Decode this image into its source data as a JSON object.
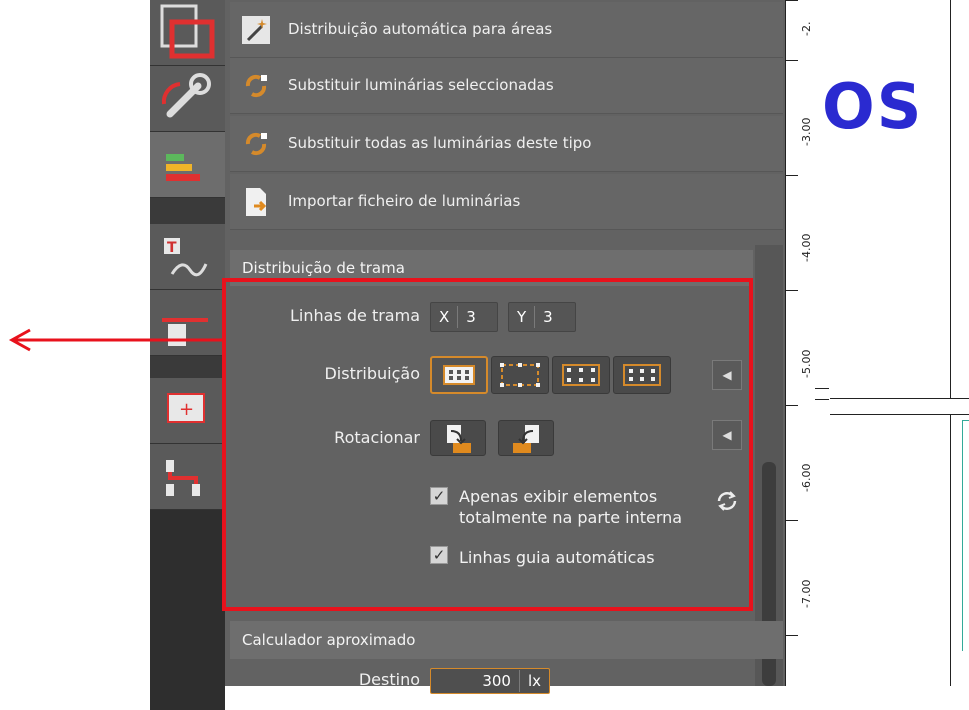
{
  "menu": {
    "items": [
      {
        "label": "Distribuição automática para áreas",
        "icon": "magic-wand-icon"
      },
      {
        "label": "Substituir luminárias seleccionadas",
        "icon": "replace-arrows-icon"
      },
      {
        "label": "Substituir todas as luminárias deste tipo",
        "icon": "replace-all-arrows-icon"
      },
      {
        "label": "Importar ficheiro de luminárias",
        "icon": "import-file-icon"
      }
    ]
  },
  "grid_distribution": {
    "title": "Distribuição de trama",
    "grid_lines_label": "Linhas de trama",
    "x_label": "X",
    "x_value": "3",
    "y_label": "Y",
    "y_value": "3",
    "distribution_label": "Distribuição",
    "rotate_label": "Rotacionar",
    "checkbox_inside_label": "Apenas exibir elementos totalmente na parte interna",
    "checkbox_inside_checked": true,
    "checkbox_guides_label": "Linhas guia automáticas",
    "checkbox_guides_checked": true
  },
  "approx_calculator": {
    "title": "Calculador aproximado",
    "field_label": "Destino",
    "field_value": "300",
    "field_unit": "lx"
  },
  "ruler": {
    "labels": [
      "-2.",
      "-3.00",
      "-4.00",
      "-5.00",
      "-6.00",
      "-7.00"
    ]
  },
  "canvas": {
    "text": "OS"
  },
  "colors": {
    "highlight": "#e8121c",
    "accent": "#d58a2b",
    "canvas_text": "#2a2ad0"
  }
}
